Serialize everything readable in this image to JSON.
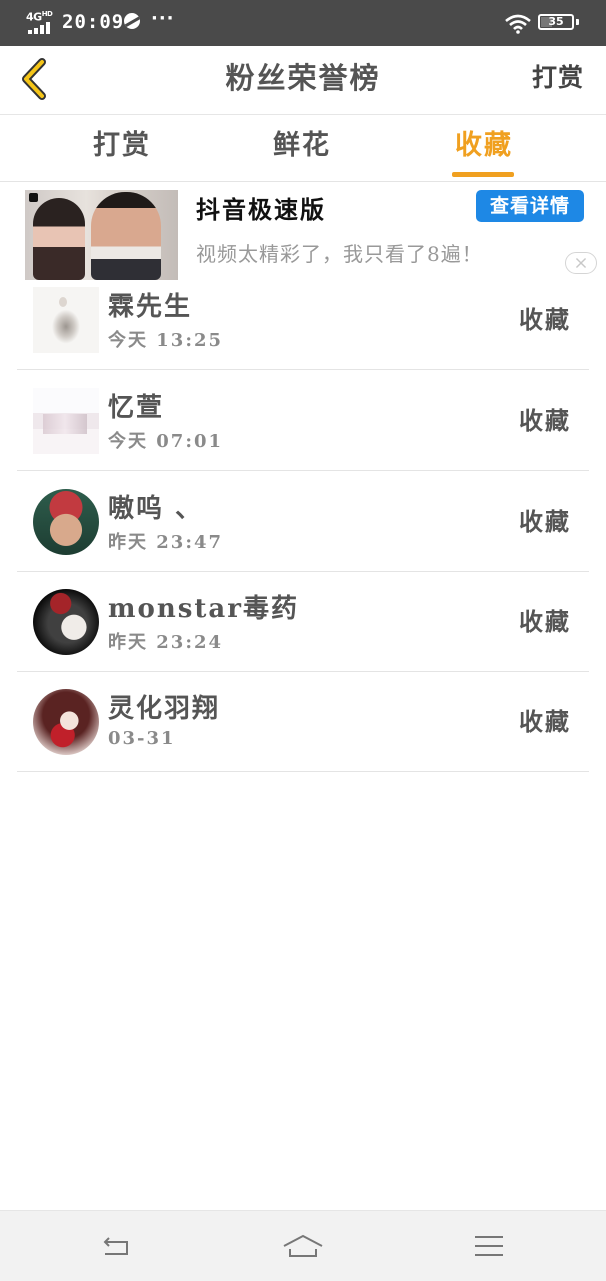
{
  "status_bar": {
    "network": "4G",
    "network_sup": "HD",
    "time": "20:09",
    "more": "···",
    "battery": "35",
    "battery_level": 0.35
  },
  "header": {
    "title": "粉丝荣誉榜",
    "right_link": "打赏",
    "back_icon": "chevron-left-icon"
  },
  "tabs": [
    {
      "label": "打赏",
      "active": false
    },
    {
      "label": "鲜花",
      "active": false
    },
    {
      "label": "收藏",
      "active": true
    }
  ],
  "ad": {
    "app_name": "抖音极速版",
    "button": "查看详情",
    "description": "视频太精彩了，我只看了8遍！"
  },
  "fans": [
    {
      "name": "霖先生",
      "time": "今天 13:25",
      "action": "收藏"
    },
    {
      "name": "忆萱",
      "time": "今天 07:01",
      "action": "收藏"
    },
    {
      "name": "嗷呜 、",
      "time": "昨天 23:47",
      "action": "收藏"
    },
    {
      "name": "monstar毒药",
      "time": "昨天 23:24",
      "action": "收藏"
    },
    {
      "name": "灵化羽翔",
      "time": "03-31",
      "action": "收藏"
    }
  ],
  "colors": {
    "accent": "#f0a020",
    "ad_button": "#1e88e5",
    "status_bar": "#4a4a4a"
  },
  "nav": [
    "back-icon",
    "home-icon",
    "menu-icon"
  ]
}
